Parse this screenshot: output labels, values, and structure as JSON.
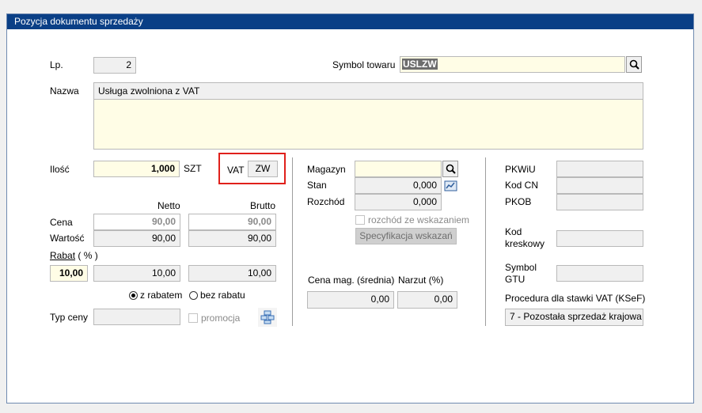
{
  "window": {
    "title": "Pozycja dokumentu sprzedaży"
  },
  "lp": {
    "label": "Lp.",
    "value": "2"
  },
  "symbol": {
    "label": "Symbol towaru",
    "value": "USLZW"
  },
  "nazwa": {
    "label": "Nazwa",
    "line1": "Usługa zwolniona z VAT"
  },
  "ilosc": {
    "label": "Ilość",
    "value": "1,000",
    "unit": "SZT"
  },
  "vat": {
    "label": "VAT",
    "value": "ZW"
  },
  "headers": {
    "netto": "Netto",
    "brutto": "Brutto"
  },
  "cena": {
    "label": "Cena",
    "netto": "90,00",
    "brutto": "90,00"
  },
  "wartosc": {
    "label": "Wartość",
    "netto": "90,00",
    "brutto": "90,00"
  },
  "rabat": {
    "label": "Rabat",
    "unit": "( % )",
    "percent": "10,00",
    "netto": "10,00",
    "brutto": "10,00"
  },
  "radio": {
    "z_rabatem": "z rabatem",
    "bez_rabatu": "bez rabatu"
  },
  "typ_ceny": {
    "label": "Typ ceny",
    "value": ""
  },
  "promocja": {
    "label": "promocja"
  },
  "magazyn": {
    "label": "Magazyn",
    "value": ""
  },
  "stan": {
    "label": "Stan",
    "value": "0,000"
  },
  "rozchod": {
    "label": "Rozchód",
    "value": "0,000"
  },
  "rozchod_check": {
    "label": "rozchód ze wskazaniem"
  },
  "spec_button": {
    "label": "Specyfikacja wskazań"
  },
  "cena_mag": {
    "label": "Cena mag. (średnia)",
    "value": "0,00"
  },
  "narzut": {
    "label": "Narzut (%)",
    "value": "0,00"
  },
  "pkwiu": {
    "label": "PKWiU",
    "value": ""
  },
  "kodcn": {
    "label": "Kod CN",
    "value": ""
  },
  "pkob": {
    "label": "PKOB",
    "value": ""
  },
  "kod_kreskowy": {
    "label_line1": "Kod",
    "label_line2": "kreskowy",
    "value": ""
  },
  "symbol_gtu": {
    "label_line1": "Symbol",
    "label_line2": "GTU",
    "value": ""
  },
  "procedura": {
    "label": "Procedura dla stawki VAT (KSeF)",
    "value": "7 - Pozostała sprzedaż krajowa"
  },
  "colors": {
    "titlebar": "#0a3f86",
    "highlight": "#e0201b",
    "input_yellow": "#fffde6"
  }
}
